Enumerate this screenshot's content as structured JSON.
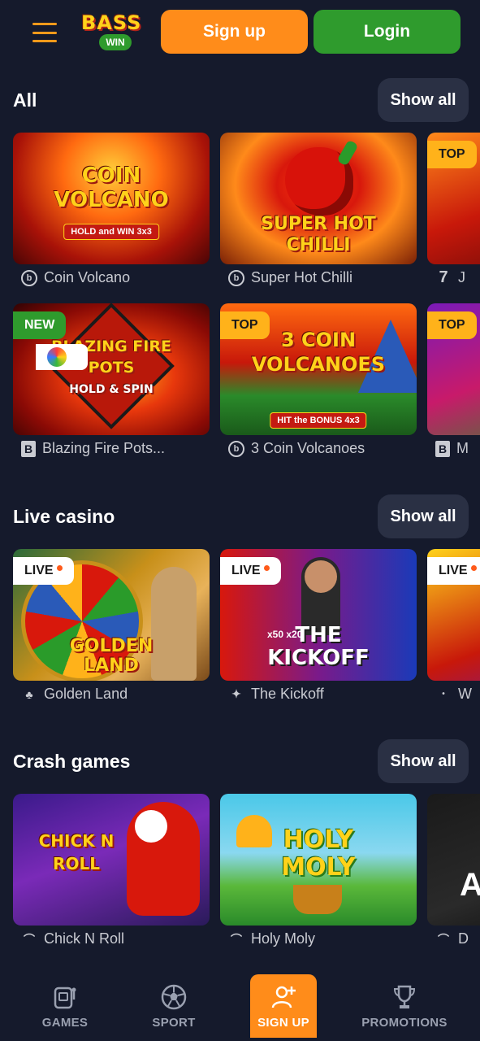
{
  "header": {
    "logo_line1": "BASS",
    "logo_line2": "WIN",
    "signup_label": "Sign up",
    "login_label": "Login"
  },
  "sections": [
    {
      "title": "All",
      "show_all": "Show all",
      "rows": [
        [
          {
            "name": "Coin Volcano",
            "provider_glyph": "b",
            "art_title": "COIN VOLCANO",
            "art_sub": "HOLD and WIN 3x3",
            "badge": ""
          },
          {
            "name": "Super Hot Chilli",
            "provider_glyph": "b",
            "art_title": "SUPER HOT CHILLI",
            "art_sub": "",
            "badge": ""
          },
          {
            "name": "J",
            "provider_glyph": "7",
            "art_title": "",
            "art_sub": "",
            "badge": "TOP"
          }
        ],
        [
          {
            "name": "Blazing Fire Pots...",
            "provider_glyph": "B",
            "art_title": "BLAZING FIRE POTS",
            "art_sub": "HOLD & SPIN",
            "badge": "NEW"
          },
          {
            "name": "3 Coin Volcanoes",
            "provider_glyph": "b",
            "art_title": "3 COIN VOLCANOES",
            "art_sub": "HIT the BONUS 4x3",
            "badge": "TOP"
          },
          {
            "name": "M",
            "provider_glyph": "B",
            "art_title": "",
            "art_sub": "",
            "badge": "TOP"
          }
        ]
      ]
    },
    {
      "title": "Live casino",
      "show_all": "Show all",
      "rows": [
        [
          {
            "name": "Golden Land",
            "provider_glyph": "♣",
            "art_title": "GOLDEN LAND",
            "art_sub": "",
            "badge": "LIVE"
          },
          {
            "name": "The Kickoff",
            "provider_glyph": "✦",
            "art_title": "THE KICKOFF",
            "art_sub": "x50 x20",
            "badge": "LIVE"
          },
          {
            "name": "W",
            "provider_glyph": "•",
            "art_title": "",
            "art_sub": "",
            "badge": "LIVE"
          }
        ]
      ]
    },
    {
      "title": "Crash games",
      "show_all": "Show all",
      "rows": [
        [
          {
            "name": "Chick N Roll",
            "provider_glyph": "⌒",
            "art_title": "CHICK N ROLL",
            "art_sub": "",
            "badge": ""
          },
          {
            "name": "Holy Moly",
            "provider_glyph": "⌒",
            "art_title": "HOLY MOLY",
            "art_sub": "",
            "badge": ""
          },
          {
            "name": "D",
            "provider_glyph": "⌒",
            "art_title": "",
            "art_sub": "",
            "badge": ""
          }
        ]
      ]
    }
  ],
  "bottom_nav": [
    {
      "label": "GAMES",
      "icon": "slot-machine-icon"
    },
    {
      "label": "SPORT",
      "icon": "soccer-ball-icon"
    },
    {
      "label": "SIGN UP",
      "icon": "user-plus-icon"
    },
    {
      "label": "PROMOTIONS",
      "icon": "trophy-icon"
    }
  ],
  "colors": {
    "background": "#151a2c",
    "accent_orange": "#ff8c1a",
    "accent_green": "#2f9b2d",
    "pill": "#2a3044"
  }
}
